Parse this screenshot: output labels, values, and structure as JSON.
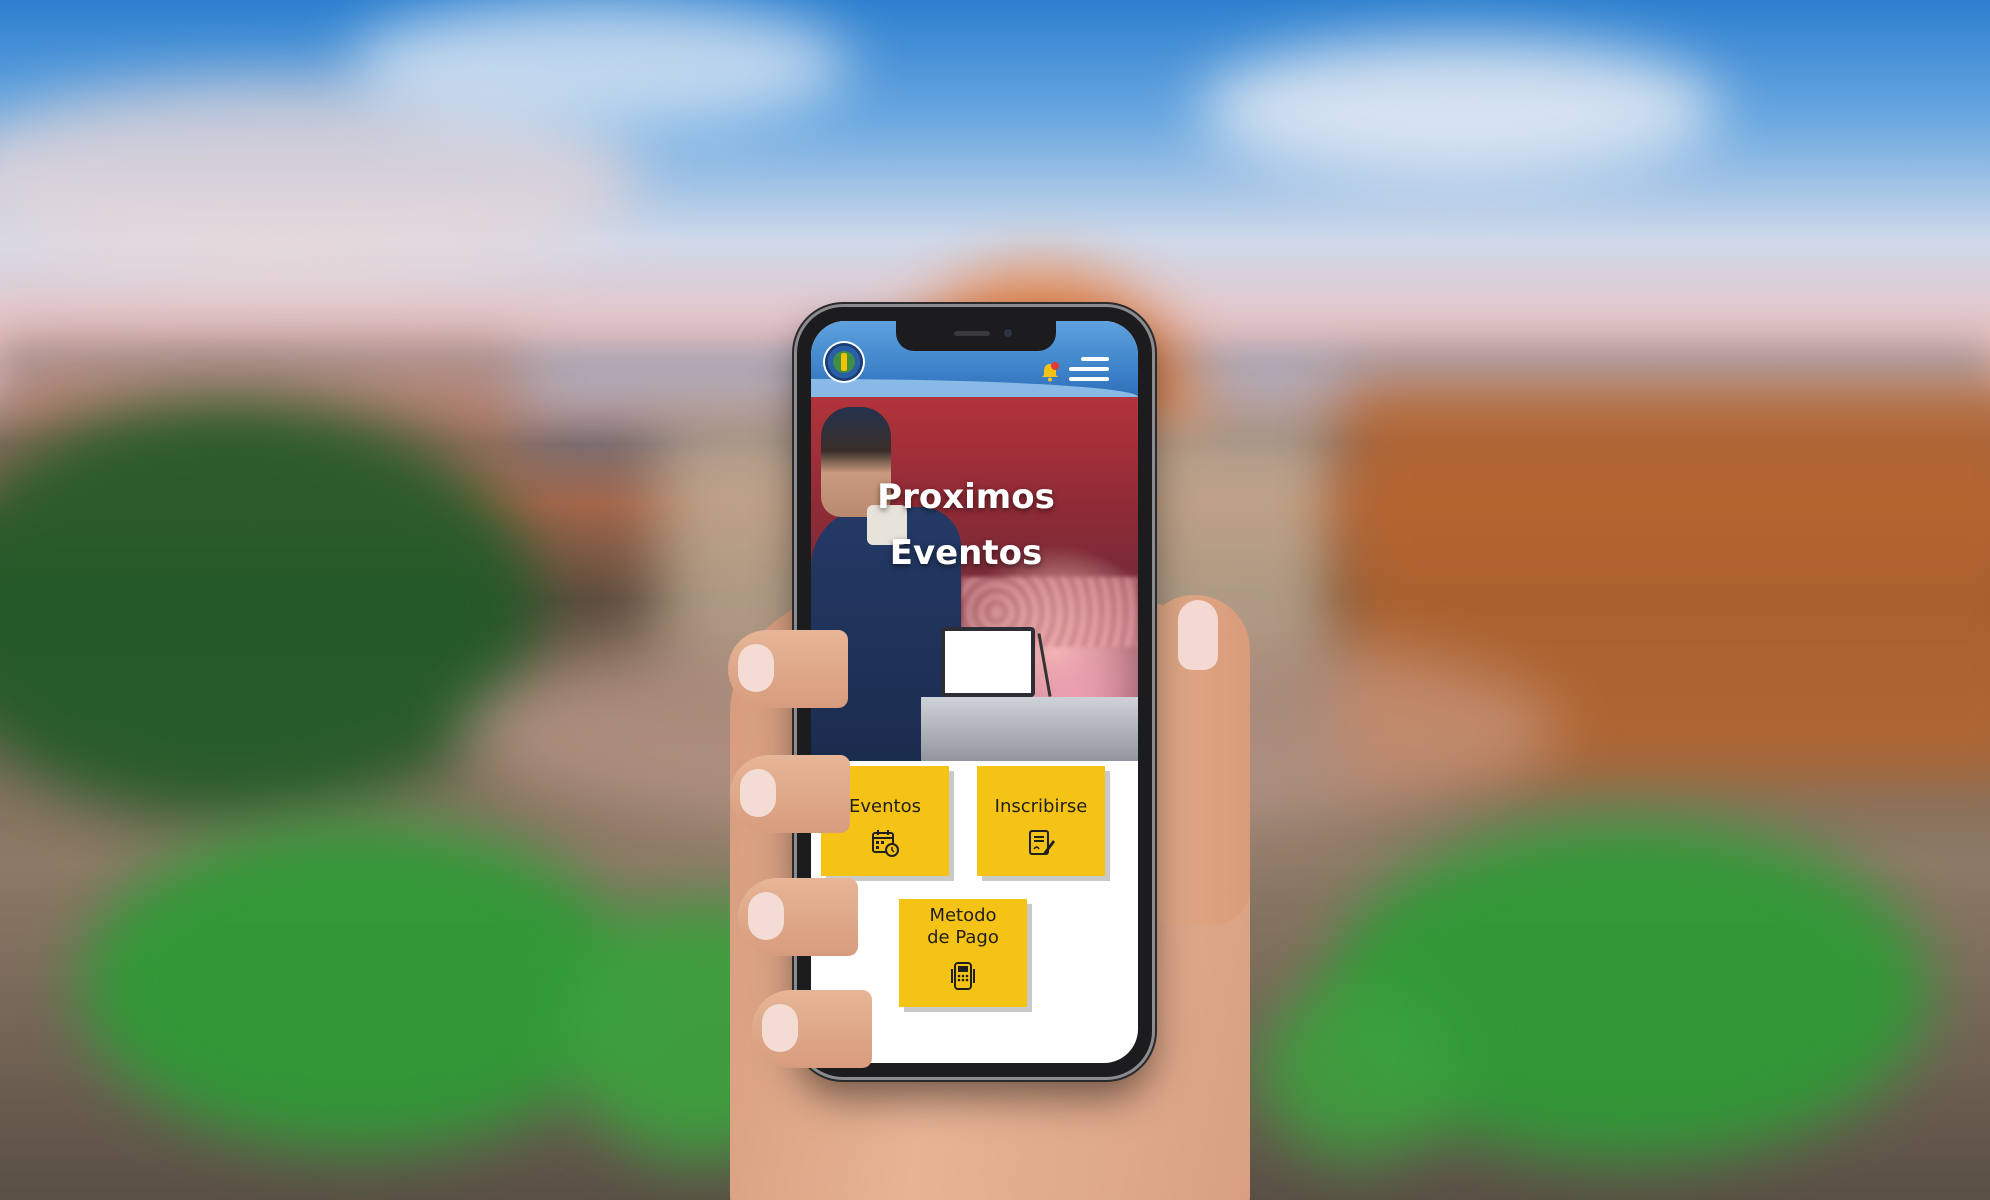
{
  "app": {
    "hero_title_line1": "Proximos",
    "hero_title_line2": "Eventos"
  },
  "header": {
    "logo_icon": "organization-seal-logo",
    "notification_icon": "bell-icon",
    "notification_badge_color": "#e53935",
    "menu_icon": "hamburger-menu-icon"
  },
  "tiles": {
    "eventos": {
      "label": "Eventos",
      "icon": "calendar-clock-icon"
    },
    "inscribirse": {
      "label": "Inscribirse",
      "icon": "signed-form-icon"
    },
    "metodo_pago": {
      "label_line1": "Metodo",
      "label_line2": "de Pago",
      "icon": "card-terminal-icon"
    }
  },
  "colors": {
    "header_blue": "#3b7fc7",
    "tile_yellow": "#f5c216",
    "hero_red": "#8f2b36"
  }
}
